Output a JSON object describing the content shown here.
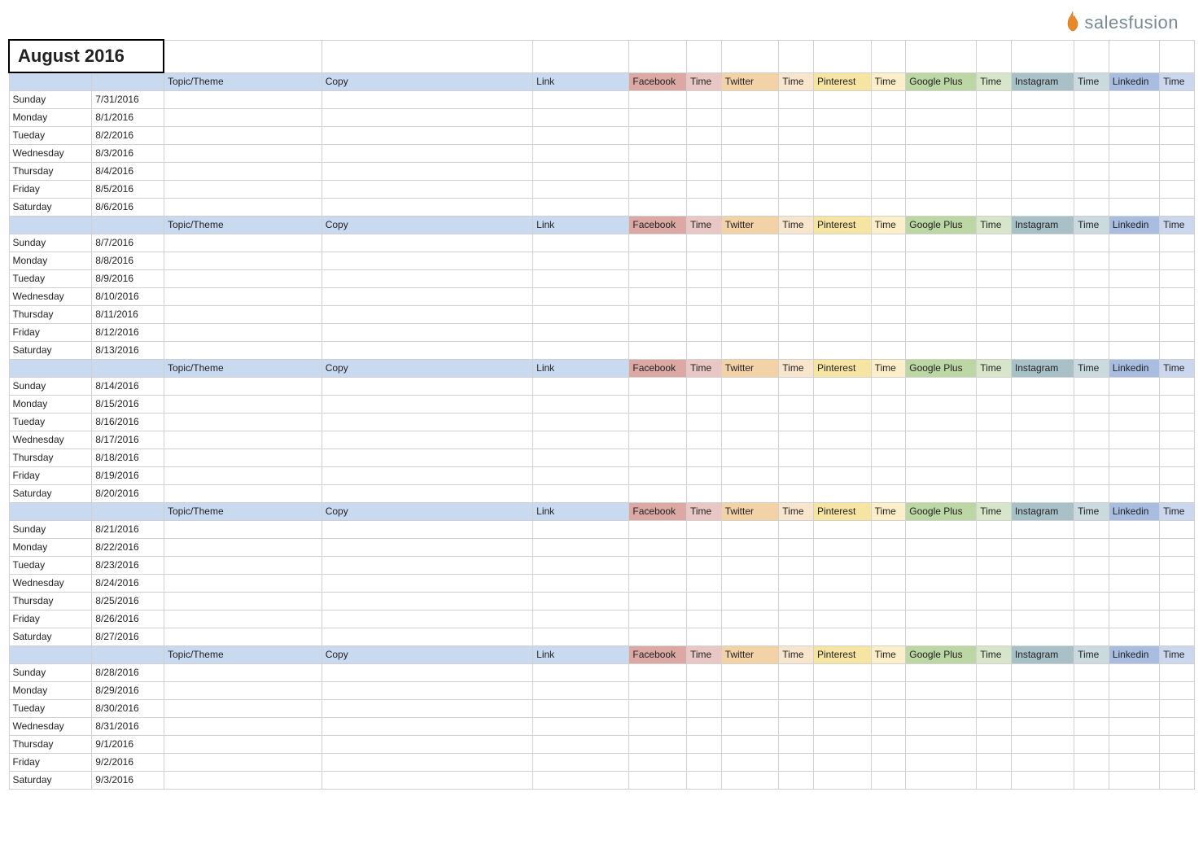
{
  "brand": {
    "name": "salesfusion",
    "accent": "#e7892a"
  },
  "title": "August 2016",
  "columns": {
    "topic": "Topic/Theme",
    "copy": "Copy",
    "link": "Link",
    "socials": [
      {
        "name": "Facebook",
        "time": "Time",
        "name_bg": "bg-fb",
        "time_bg": "bg-fb-t"
      },
      {
        "name": "Twitter",
        "time": "Time",
        "name_bg": "bg-tw",
        "time_bg": "bg-tw-t"
      },
      {
        "name": "Pinterest",
        "time": "Time",
        "name_bg": "bg-pi",
        "time_bg": "bg-pi-t"
      },
      {
        "name": "Google Plus",
        "time": "Time",
        "name_bg": "bg-gp",
        "time_bg": "bg-gp-t"
      },
      {
        "name": "Instagram",
        "time": "Time",
        "name_bg": "bg-ig",
        "time_bg": "bg-ig-t"
      },
      {
        "name": "Linkedin",
        "time": "Time",
        "name_bg": "bg-li",
        "time_bg": "bg-li-t"
      }
    ]
  },
  "weeks": [
    {
      "days": [
        {
          "dow": "Sunday",
          "date": "7/31/2016"
        },
        {
          "dow": "Monday",
          "date": "8/1/2016"
        },
        {
          "dow": "Tueday",
          "date": "8/2/2016"
        },
        {
          "dow": "Wednesday",
          "date": "8/3/2016"
        },
        {
          "dow": "Thursday",
          "date": "8/4/2016"
        },
        {
          "dow": "Friday",
          "date": "8/5/2016"
        },
        {
          "dow": "Saturday",
          "date": "8/6/2016"
        }
      ]
    },
    {
      "days": [
        {
          "dow": "Sunday",
          "date": "8/7/2016"
        },
        {
          "dow": "Monday",
          "date": "8/8/2016"
        },
        {
          "dow": "Tueday",
          "date": "8/9/2016"
        },
        {
          "dow": "Wednesday",
          "date": "8/10/2016"
        },
        {
          "dow": "Thursday",
          "date": "8/11/2016"
        },
        {
          "dow": "Friday",
          "date": "8/12/2016"
        },
        {
          "dow": "Saturday",
          "date": "8/13/2016"
        }
      ]
    },
    {
      "days": [
        {
          "dow": "Sunday",
          "date": "8/14/2016"
        },
        {
          "dow": "Monday",
          "date": "8/15/2016"
        },
        {
          "dow": "Tueday",
          "date": "8/16/2016"
        },
        {
          "dow": "Wednesday",
          "date": "8/17/2016"
        },
        {
          "dow": "Thursday",
          "date": "8/18/2016"
        },
        {
          "dow": "Friday",
          "date": "8/19/2016"
        },
        {
          "dow": "Saturday",
          "date": "8/20/2016"
        }
      ]
    },
    {
      "days": [
        {
          "dow": "Sunday",
          "date": "8/21/2016"
        },
        {
          "dow": "Monday",
          "date": "8/22/2016"
        },
        {
          "dow": "Tueday",
          "date": "8/23/2016"
        },
        {
          "dow": "Wednesday",
          "date": "8/24/2016"
        },
        {
          "dow": "Thursday",
          "date": "8/25/2016"
        },
        {
          "dow": "Friday",
          "date": "8/26/2016"
        },
        {
          "dow": "Saturday",
          "date": "8/27/2016"
        }
      ]
    },
    {
      "days": [
        {
          "dow": "Sunday",
          "date": "8/28/2016"
        },
        {
          "dow": "Monday",
          "date": "8/29/2016"
        },
        {
          "dow": "Tueday",
          "date": "8/30/2016"
        },
        {
          "dow": "Wednesday",
          "date": "8/31/2016"
        },
        {
          "dow": "Thursday",
          "date": "9/1/2016"
        },
        {
          "dow": "Friday",
          "date": "9/2/2016"
        },
        {
          "dow": "Saturday",
          "date": "9/3/2016"
        }
      ]
    }
  ]
}
